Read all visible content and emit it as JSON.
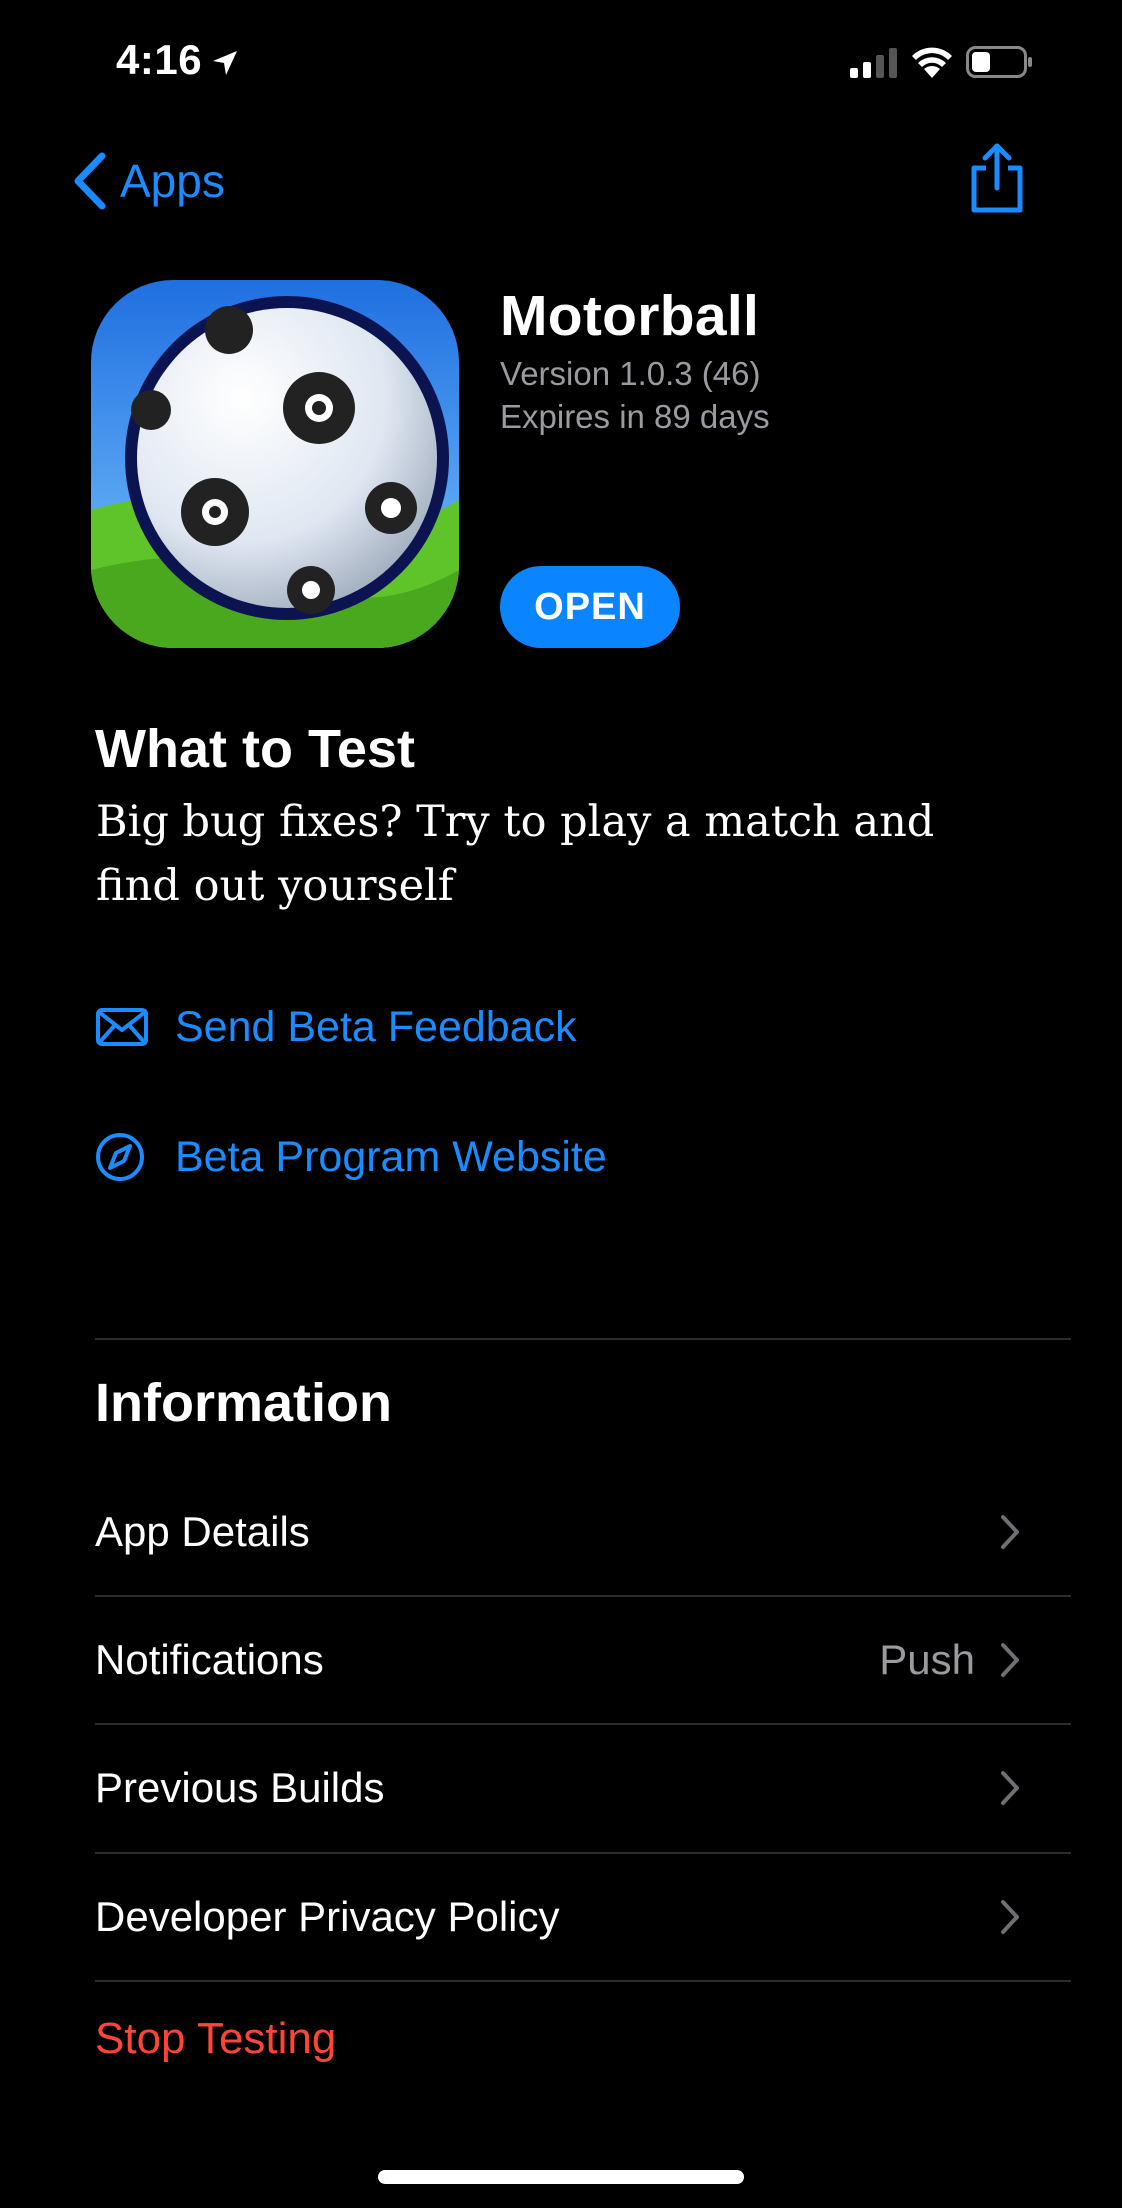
{
  "status_bar": {
    "time": "4:16",
    "icons": [
      "location-icon",
      "signal-icon",
      "wifi-icon",
      "battery-icon"
    ],
    "signal_bars_active": 2,
    "battery_level": 0.3
  },
  "nav": {
    "back_label": "Apps",
    "back_icon": "chevron-left-icon",
    "share_icon": "share-icon"
  },
  "app": {
    "name": "Motorball",
    "version": "Version 1.0.3 (46)",
    "expires": "Expires in 89 days",
    "open_label": "OPEN",
    "icon": "soccer-ball-icon"
  },
  "what_to_test": {
    "title": "What to Test",
    "body": "Big bug fixes? Try to play a match and find out yourself"
  },
  "links": [
    {
      "label": "Send Beta Feedback",
      "icon": "envelope-icon"
    },
    {
      "label": "Beta Program Website",
      "icon": "compass-icon"
    }
  ],
  "information": {
    "title": "Information",
    "rows": [
      {
        "label": "App Details",
        "value": ""
      },
      {
        "label": "Notifications",
        "value": "Push"
      },
      {
        "label": "Previous Builds",
        "value": ""
      },
      {
        "label": "Developer Privacy Policy",
        "value": ""
      }
    ]
  },
  "stop_testing": "Stop Testing",
  "colors": {
    "accent": "#0a84ff",
    "link": "#1a8cff",
    "destructive": "#ff453a",
    "secondary_text": "#9a9aa0",
    "background": "#000000"
  }
}
